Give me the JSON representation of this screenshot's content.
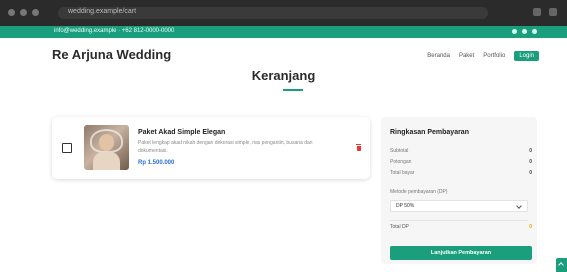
{
  "browser": {
    "url": "wedding.example/cart"
  },
  "topbar": {
    "contact": "info@wedding.example · +62 812-0000-0000"
  },
  "header": {
    "brand": "Re Arjuna Wedding",
    "nav": [
      "Beranda",
      "Paket",
      "Portfolio"
    ],
    "cta": "Login"
  },
  "page": {
    "title": "Keranjang"
  },
  "cart": {
    "items": [
      {
        "title": "Paket Akad Simple Elegan",
        "description": "Paket lengkap akad nikah dengan dekorasi simple, rias pengantin, busana dan dokumentasi.",
        "price": "Rp 1.500.000",
        "checked": false
      }
    ]
  },
  "summary": {
    "title": "Ringkasan Pembayaran",
    "rows": [
      {
        "label": "Subtotal",
        "value": "0"
      },
      {
        "label": "Potongan",
        "value": "0"
      },
      {
        "label": "Total bayar",
        "value": "0"
      }
    ],
    "payment_label": "Metode pembayaran (DP)",
    "payment_selected": "DP 50%",
    "total_label": "Total DP",
    "total_value": "0",
    "pay_button": "Lanjutkan Pembayaran"
  },
  "colors": {
    "primary": "#1a9e7c",
    "price": "#2b6fd6",
    "delete": "#e53935",
    "total": "#e0a800"
  },
  "icons": {
    "delete": "trash-icon",
    "select": "chevron-down-icon",
    "scroll": "arrow-up-icon"
  }
}
